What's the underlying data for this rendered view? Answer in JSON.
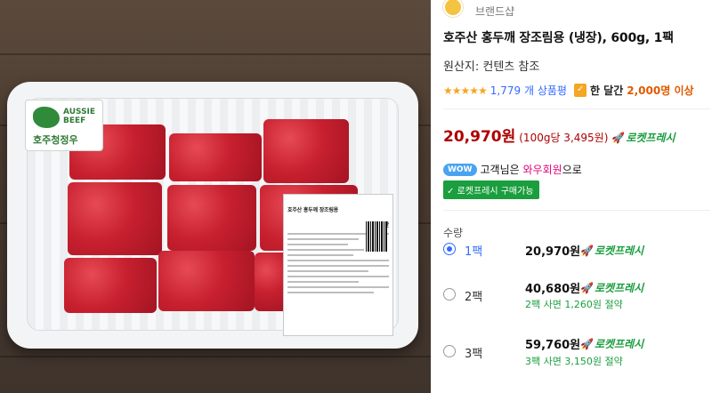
{
  "image": {
    "sticker_brand": "AUSSIE BEEF",
    "sticker_korean": "호주청정우",
    "label_title": "호주산 홍두깨 장조림용",
    "label_origin": "호주산"
  },
  "product": {
    "brand_name": "브랜드샵",
    "title": "호주산 홍두깨 장조림용 (냉장), 600g, 1팩",
    "origin": "원산지: 컨텐츠 참조",
    "rating_stars": "★★★★★",
    "review_count": "1,779 개 상품평",
    "month_label": "한 달간",
    "month_count": "2,000명 이상",
    "price": "20,970원",
    "unit_price": "(100g당 3,495원)",
    "rocket_label": "로켓프레시",
    "wow_badge": "WOW",
    "wow_text_prefix": "고객님은",
    "wow_text_highlight": "와우회원",
    "wow_text_suffix": "으로",
    "rocket_buy_label": "✓ 로켓프레시 구매가능"
  },
  "quantity": {
    "label": "수량",
    "options": [
      {
        "name": "1팩",
        "price": "20,970원",
        "rocket": "로켓프레시",
        "save": "",
        "selected": true
      },
      {
        "name": "2팩",
        "price": "40,680원",
        "rocket": "로켓프레시",
        "save": "2팩 사면 1,260원 절약",
        "selected": false
      },
      {
        "name": "3팩",
        "price": "59,760원",
        "rocket": "로켓프레시",
        "save": "3팩 사면 3,150원 절약",
        "selected": false
      }
    ]
  },
  "colors": {
    "price_red": "#ae0000",
    "rocket_green": "#1a9e3e",
    "link_blue": "#346aff",
    "wow_blue": "#4aa3f0"
  },
  "icons": [
    "brand-logo-icon",
    "star-icon",
    "bag-check-icon",
    "rocket-icon",
    "radio-icon"
  ]
}
